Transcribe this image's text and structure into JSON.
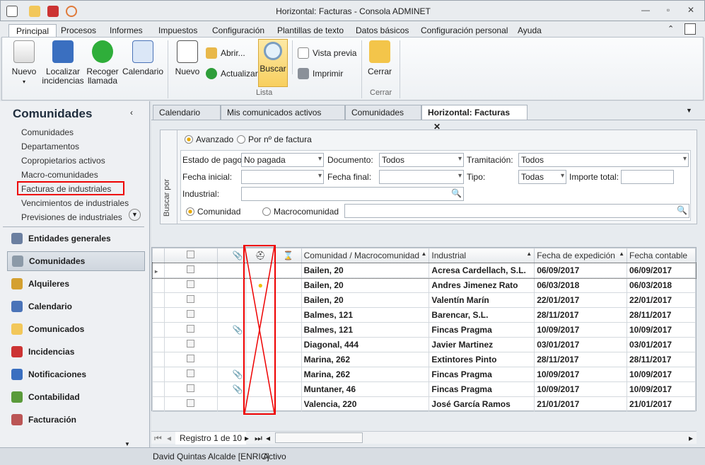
{
  "window": {
    "title": "Horizontal: Facturas - Consola ADMINET"
  },
  "ribbon_tabs": [
    "Principal",
    "Procesos",
    "Informes",
    "Impuestos",
    "Configuración",
    "Plantillas de texto",
    "Datos básicos",
    "Configuración personal",
    "Ayuda"
  ],
  "ribbon": {
    "nuevo": "Nuevo",
    "localizar": "Localizar",
    "incidencias": "incidencias",
    "recoger": "Recoger",
    "llamada": "llamada",
    "calendario": "Calendario",
    "nuevo2": "Nuevo",
    "abrir": "Abrir...",
    "actualizar": "Actualizar",
    "buscar": "Buscar",
    "vista_previa": "Vista previa",
    "imprimir": "Imprimir",
    "cerrar": "Cerrar",
    "group_lista": "Lista",
    "group_cerrar": "Cerrar"
  },
  "left": {
    "title": "Comunidades",
    "links": [
      "Comunidades",
      "Departamentos",
      "Copropietarios activos",
      "Macro-comunidades",
      "Facturas de industriales",
      "Vencimientos de industriales",
      "Previsiones de industriales"
    ],
    "nav": [
      "Entidades generales",
      "Comunidades",
      "Alquileres",
      "Calendario",
      "Comunicados",
      "Incidencias",
      "Notificaciones",
      "Contabilidad",
      "Facturación"
    ]
  },
  "doc_tabs": [
    "Calendario",
    "Mis comunicados activos",
    "Comunidades",
    "Horizontal: Facturas"
  ],
  "filter": {
    "side_label": "Buscar por",
    "mode_avanzado": "Avanzado",
    "mode_num": "Por nº de factura",
    "estado_label": "Estado de pago:",
    "estado_value": "No pagada",
    "documento_label": "Documento:",
    "documento_value": "Todos",
    "tramitacion_label": "Tramitación:",
    "tramitacion_value": "Todos",
    "fecha_ini_label": "Fecha inicial:",
    "fecha_fin_label": "Fecha final:",
    "tipo_label": "Tipo:",
    "tipo_value": "Todas",
    "importe_label": "Importe total:",
    "industrial_label": "Industrial:",
    "comunidad": "Comunidad",
    "macrocomunidad": "Macrocomunidad"
  },
  "grid": {
    "columns": [
      "Comunidad / Macrocomunidad",
      "Industrial",
      "Fecha de expedición",
      "Fecha contable"
    ],
    "rows": [
      {
        "comunidad": "Bailen, 20",
        "industrial": "Acresa Cardellach, S.L.",
        "exp": "06/09/2017",
        "cont": "06/09/2017",
        "clip": false,
        "helmet": false
      },
      {
        "comunidad": "Bailen, 20",
        "industrial": "Andres Jimenez Rato",
        "exp": "06/03/2018",
        "cont": "06/03/2018",
        "clip": false,
        "helmet": true
      },
      {
        "comunidad": "Bailen, 20",
        "industrial": "Valentín Marín",
        "exp": "22/01/2017",
        "cont": "22/01/2017",
        "clip": false,
        "helmet": false
      },
      {
        "comunidad": "Balmes, 121",
        "industrial": "Barencar, S.L.",
        "exp": "28/11/2017",
        "cont": "28/11/2017",
        "clip": false,
        "helmet": false
      },
      {
        "comunidad": "Balmes, 121",
        "industrial": "Fincas Pragma",
        "exp": "10/09/2017",
        "cont": "10/09/2017",
        "clip": true,
        "helmet": false
      },
      {
        "comunidad": "Diagonal, 444",
        "industrial": "Javier Martinez",
        "exp": "03/01/2017",
        "cont": "03/01/2017",
        "clip": false,
        "helmet": false
      },
      {
        "comunidad": "Marina, 262",
        "industrial": "Extintores Pinto",
        "exp": "28/11/2017",
        "cont": "28/11/2017",
        "clip": false,
        "helmet": false
      },
      {
        "comunidad": "Marina, 262",
        "industrial": "Fincas Pragma",
        "exp": "10/09/2017",
        "cont": "10/09/2017",
        "clip": true,
        "helmet": false
      },
      {
        "comunidad": "Muntaner, 46",
        "industrial": "Fincas Pragma",
        "exp": "10/09/2017",
        "cont": "10/09/2017",
        "clip": true,
        "helmet": false
      },
      {
        "comunidad": "Valencia, 220",
        "industrial": "José García Ramos",
        "exp": "21/01/2017",
        "cont": "21/01/2017",
        "clip": false,
        "helmet": false
      }
    ],
    "record": "Registro 1 de 10"
  },
  "status": {
    "user": "David Quintas Alcalde [ENRIC]",
    "state": "Activo"
  }
}
